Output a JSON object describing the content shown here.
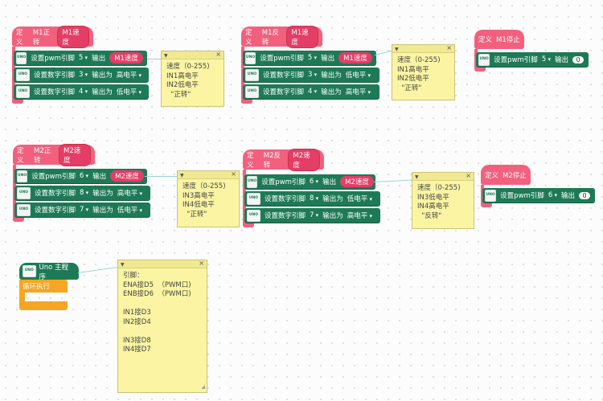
{
  "common": {
    "define": "定义",
    "set_pwm": "设置pwm引脚",
    "output": "输出",
    "set_digital": "设置数字引脚",
    "output_as": "输出为",
    "uno_icon": "UNO",
    "note_collapse_icon": "triangle-down-icon",
    "note_close_icon": "close-icon"
  },
  "colors": {
    "define_block": "#f2607e",
    "param_pill": "#e43d66",
    "io_block": "#1e7a56",
    "loop_block": "#f5a623",
    "note_bg": "#fbf5a3"
  },
  "blocks": {
    "m1_forward": {
      "name": "M1正转",
      "param": "M1速度",
      "pwm_pin": "5",
      "pwm_value": "M1速度",
      "pin_a": "3",
      "level_a": "高电平",
      "pin_b": "4",
      "level_b": "低电平"
    },
    "m1_reverse": {
      "name": "M1反转",
      "param": "M1速度",
      "pwm_pin": "5",
      "pwm_value": "M1速度",
      "pin_a": "3",
      "level_a": "低电平",
      "pin_b": "4",
      "level_b": "高电平"
    },
    "m1_stop": {
      "name": "M1停止",
      "pwm_pin": "5",
      "pwm_value": "0"
    },
    "m2_forward": {
      "name": "M2正转",
      "param": "M2速度",
      "pwm_pin": "6",
      "pwm_value": "M2速度",
      "pin_a": "8",
      "level_a": "高电平",
      "pin_b": "7",
      "level_b": "低电平"
    },
    "m2_reverse": {
      "name": "M2反转",
      "param": "M2速度",
      "pwm_pin": "6",
      "pwm_value": "M2速度",
      "pin_a": "8",
      "level_a": "低电平",
      "pin_b": "7",
      "level_b": "高电平"
    },
    "m2_stop": {
      "name": "M2停止",
      "pwm_pin": "6",
      "pwm_value": "0"
    },
    "main": {
      "title": "Uno 主程序",
      "loop": "循环执行"
    }
  },
  "notes": {
    "m1_forward": "速度（0-255)\nIN1高电平\nIN2低电平\n  \"正转\"",
    "m1_reverse": "速度（0-255)\nIN1高电平\nIN2低电平\n  \"正转\"",
    "m2_forward": "速度（0-255)\nIN3高电平\nIN4低电平\n  \"正转\"",
    "m2_reverse": "速度（0-255)\nIN3低电平\nIN4高电平\n  \"反转\"",
    "main": "引脚：\nENA接D5  （PWM口)\nENB接D6  （PWM口)\n\nIN1接D3\nIN2接D4\n\nIN3接D8\nIN4接D7"
  }
}
